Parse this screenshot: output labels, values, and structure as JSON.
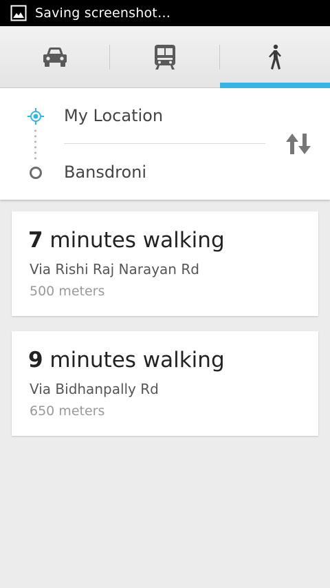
{
  "status_bar": {
    "notification_icon": "image-icon",
    "text": "Saving screenshot…"
  },
  "mode_tabs": [
    {
      "icon": "car-icon",
      "name": "driving",
      "active": false
    },
    {
      "icon": "transit-icon",
      "name": "transit",
      "active": false
    },
    {
      "icon": "walking-icon",
      "name": "walking",
      "active": true
    }
  ],
  "route": {
    "origin": "My Location",
    "destination": "Bansdroni",
    "swap_icon": "swap-vertical-icon"
  },
  "results": [
    {
      "duration_number": "7",
      "duration_text": " minutes walking",
      "via": "Via Rishi Raj Narayan Rd",
      "distance": "500 meters"
    },
    {
      "duration_number": "9",
      "duration_text": " minutes walking",
      "via": "Via Bidhanpally Rd",
      "distance": "650 meters"
    }
  ],
  "colors": {
    "accent": "#33b5e5",
    "background": "#ececec"
  }
}
